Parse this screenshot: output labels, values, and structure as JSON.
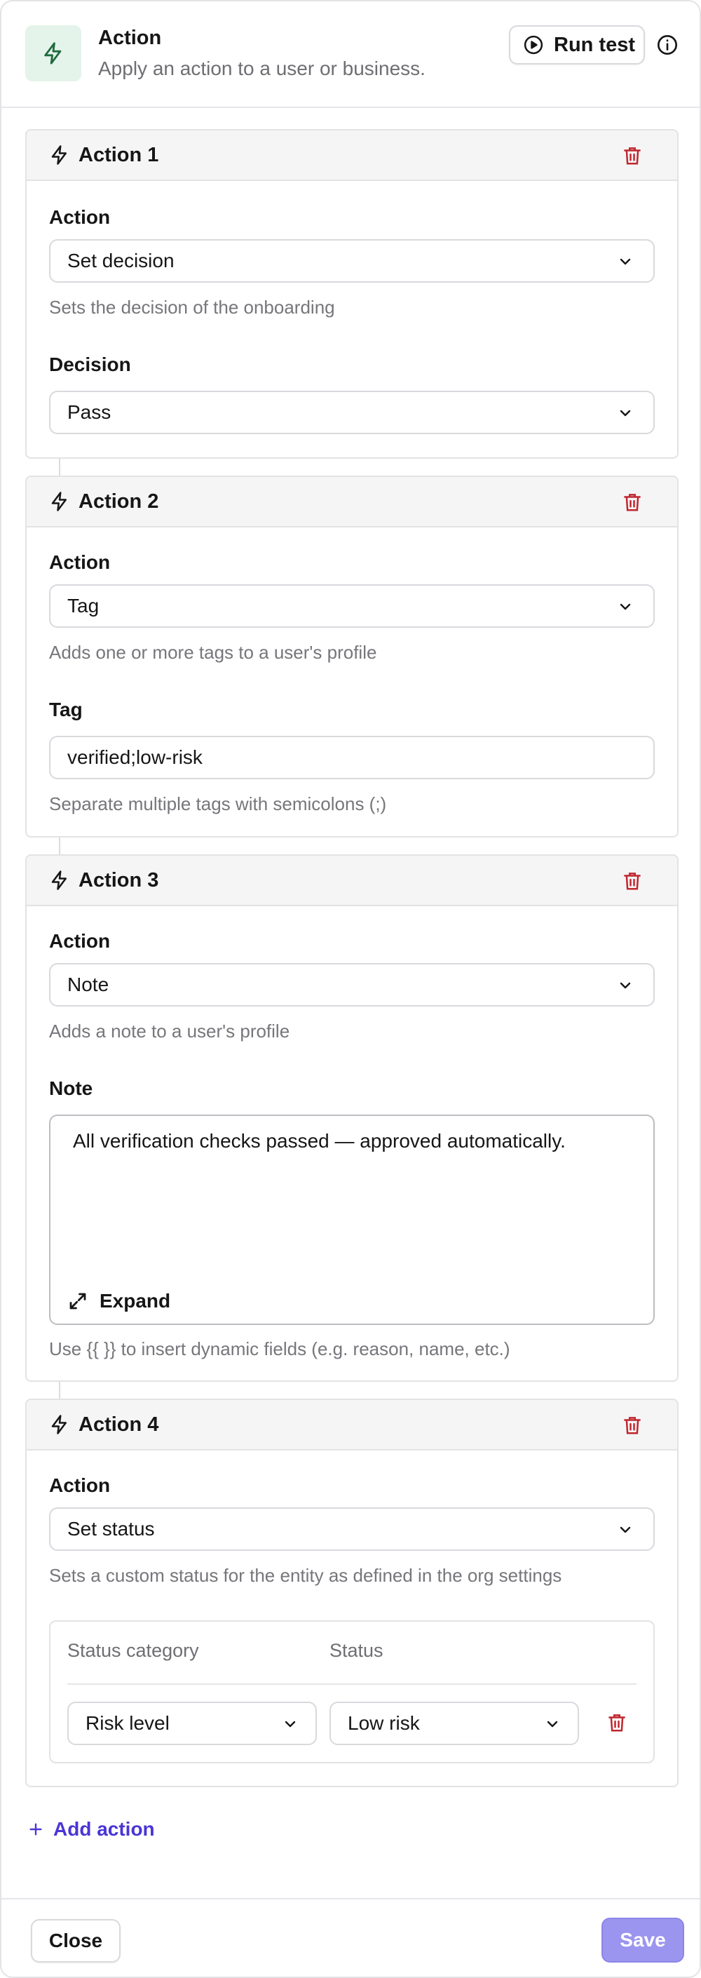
{
  "header": {
    "title": "Action",
    "subtitle": "Apply an action to a user or business.",
    "run_test_label": "Run test"
  },
  "actions": [
    {
      "title": "Action 1",
      "action_label": "Action",
      "action_value": "Set decision",
      "action_hint": "Sets the decision of the onboarding",
      "field_label": "Decision",
      "field_value": "Pass"
    },
    {
      "title": "Action 2",
      "action_label": "Action",
      "action_value": "Tag",
      "action_hint": "Adds one or more tags to a user's profile",
      "field_label": "Tag",
      "field_value": "verified;low-risk",
      "field_hint": "Separate multiple tags with semicolons (;)"
    },
    {
      "title": "Action 3",
      "action_label": "Action",
      "action_value": "Note",
      "action_hint": "Adds a note to a user's profile",
      "field_label": "Note",
      "field_value": "All verification checks passed — approved automatically.",
      "expand_label": "Expand",
      "field_hint": "Use {{ }} to insert dynamic fields (e.g. reason, name, etc.)"
    },
    {
      "title": "Action 4",
      "action_label": "Action",
      "action_value": "Set status",
      "action_hint": "Sets a custom status for the entity as defined in the org settings",
      "status_table": {
        "col_category": "Status category",
        "col_status": "Status",
        "rows": [
          {
            "category": "Risk level",
            "status": "Low risk"
          }
        ]
      }
    }
  ],
  "add_action_label": "Add action",
  "footer": {
    "close_label": "Close",
    "save_label": "Save"
  },
  "colors": {
    "accent": "#4a35d6",
    "save_disabled": "#9c95ef",
    "danger": "#c0262d",
    "icon_green_bg": "#e4f4ea"
  }
}
